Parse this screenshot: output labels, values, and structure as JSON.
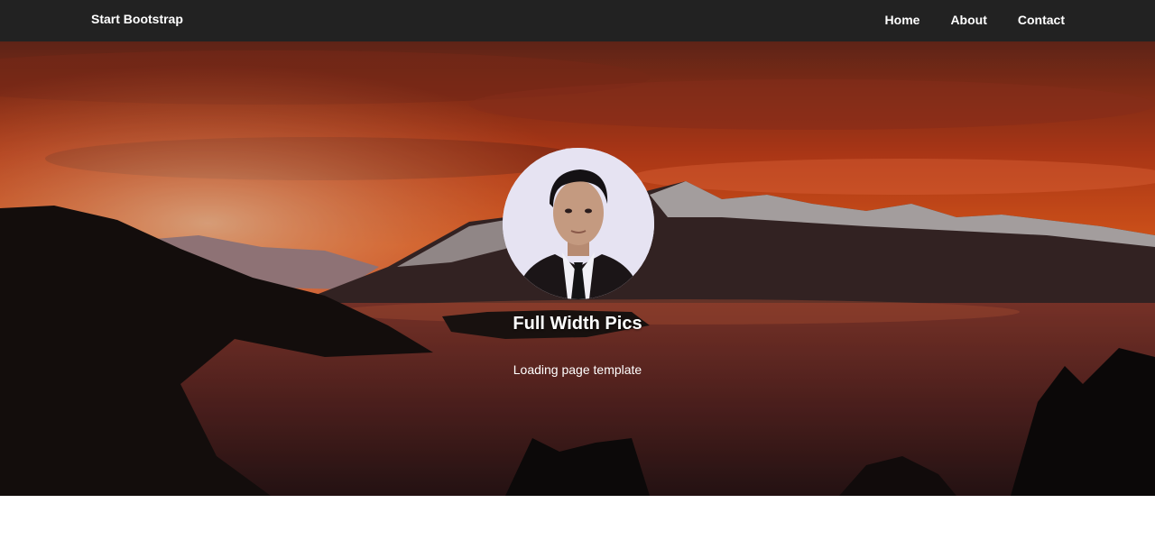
{
  "navbar": {
    "brand": "Start Bootstrap",
    "links": [
      {
        "label": "Home"
      },
      {
        "label": "About"
      },
      {
        "label": "Contact"
      }
    ]
  },
  "hero": {
    "title": "Full Width Pics",
    "subtitle": "Loading page template"
  },
  "colors": {
    "navbar_bg": "#222222",
    "sky_orange": "#ff5a1e",
    "text": "#ffffff"
  }
}
